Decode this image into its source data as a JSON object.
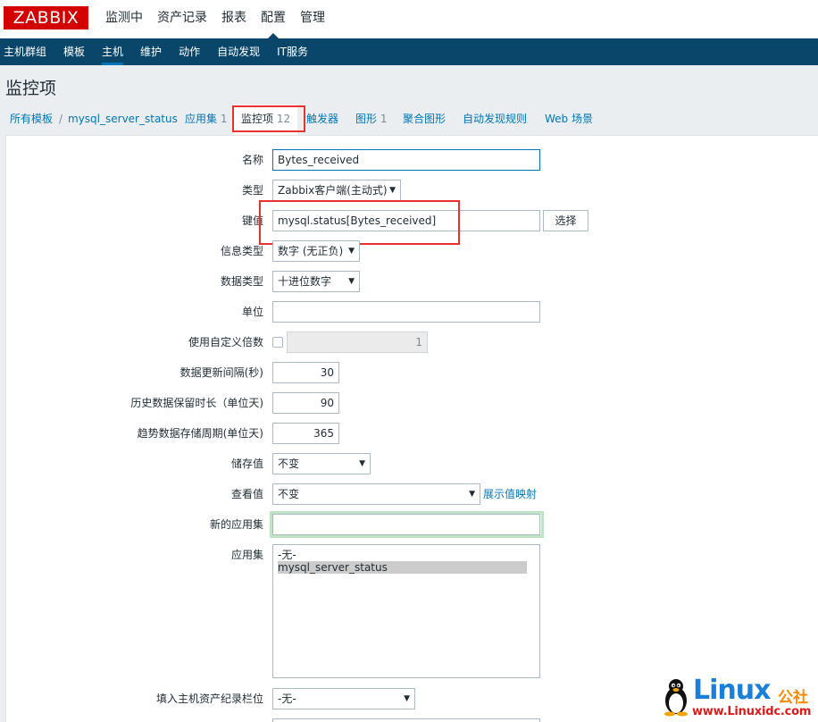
{
  "app": {
    "logo": "ZABBIX"
  },
  "top_menu": [
    "监测中",
    "资产记录",
    "报表",
    "配置",
    "管理"
  ],
  "sub_menu": [
    "主机群组",
    "模板",
    "主机",
    "维护",
    "动作",
    "自动发现",
    "IT服务"
  ],
  "page_title": "监控项",
  "breadcrumb": {
    "all_templates": "所有模板",
    "separator": "/",
    "template": "mysql_server_status",
    "applications": {
      "label": "应用集",
      "count": "1"
    },
    "items": {
      "label": "监控项",
      "count": "12"
    },
    "triggers": "触发器",
    "graphs": {
      "label": "图形",
      "count": "1"
    },
    "screens": "聚合图形",
    "discovery": "自动发现规则",
    "web": "Web 场景"
  },
  "form": {
    "name": {
      "label": "名称",
      "value": "Bytes_received"
    },
    "type": {
      "label": "类型",
      "value": "Zabbix客户端(主动式)"
    },
    "key": {
      "label": "键值",
      "value": "mysql.status[Bytes_received]",
      "button": "选择"
    },
    "value_type": {
      "label": "信息类型",
      "value": "数字 (无正负)"
    },
    "data_type": {
      "label": "数据类型",
      "value": "十进位数字"
    },
    "units": {
      "label": "单位",
      "value": ""
    },
    "multiplier": {
      "label": "使用自定义倍数",
      "value": "1"
    },
    "delay": {
      "label": "数据更新间隔(秒)",
      "value": "30"
    },
    "history": {
      "label": "历史数据保留时长（单位天)",
      "value": "90"
    },
    "trends": {
      "label": "趋势数据存储周期(单位天)",
      "value": "365"
    },
    "store": {
      "label": "储存值",
      "value": "不变"
    },
    "show": {
      "label": "查看值",
      "value": "不变",
      "link": "展示值映射"
    },
    "new_app": {
      "label": "新的应用集",
      "value": ""
    },
    "apps": {
      "label": "应用集",
      "options": [
        "-无-",
        "mysql_server_status"
      ]
    },
    "inventory": {
      "label": "填入主机资产纪录栏位",
      "value": "-无-"
    }
  },
  "watermark": {
    "title": "Linux",
    "suffix": "公社",
    "url": "www.Linuxidc.com"
  },
  "colors": {
    "brand": "#d40000",
    "nav": "#0a466a",
    "link": "#0275b8",
    "highlight": "#e8322f"
  }
}
